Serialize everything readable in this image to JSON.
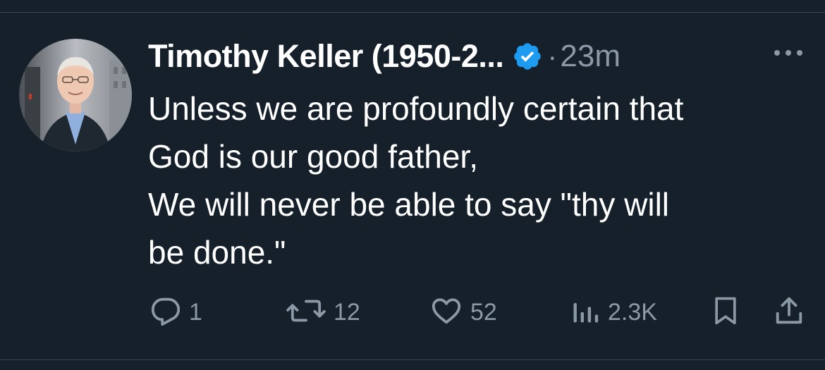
{
  "tweet": {
    "author_name": "Timothy Keller (1950-2...",
    "verified": true,
    "separator": "·",
    "timestamp": "23m",
    "text_lines": [
      "Unless we are profoundly certain that",
      "God is our good father,",
      "We will never be able to say \"thy will",
      "be done.\""
    ]
  },
  "actions": {
    "replies": "1",
    "retweets": "12",
    "likes": "52",
    "views": "2.3K"
  },
  "icons": {
    "more": "more-horizontal-icon",
    "verified": "verified-badge-icon",
    "reply": "reply-icon",
    "retweet": "retweet-icon",
    "like": "heart-icon",
    "views": "views-chart-icon",
    "bookmark": "bookmark-icon",
    "share": "share-icon"
  },
  "colors": {
    "background": "#15202b",
    "text": "#ffffff",
    "muted": "#8b98a5",
    "verified": "#1d9bf0",
    "divider": "#38444d"
  }
}
